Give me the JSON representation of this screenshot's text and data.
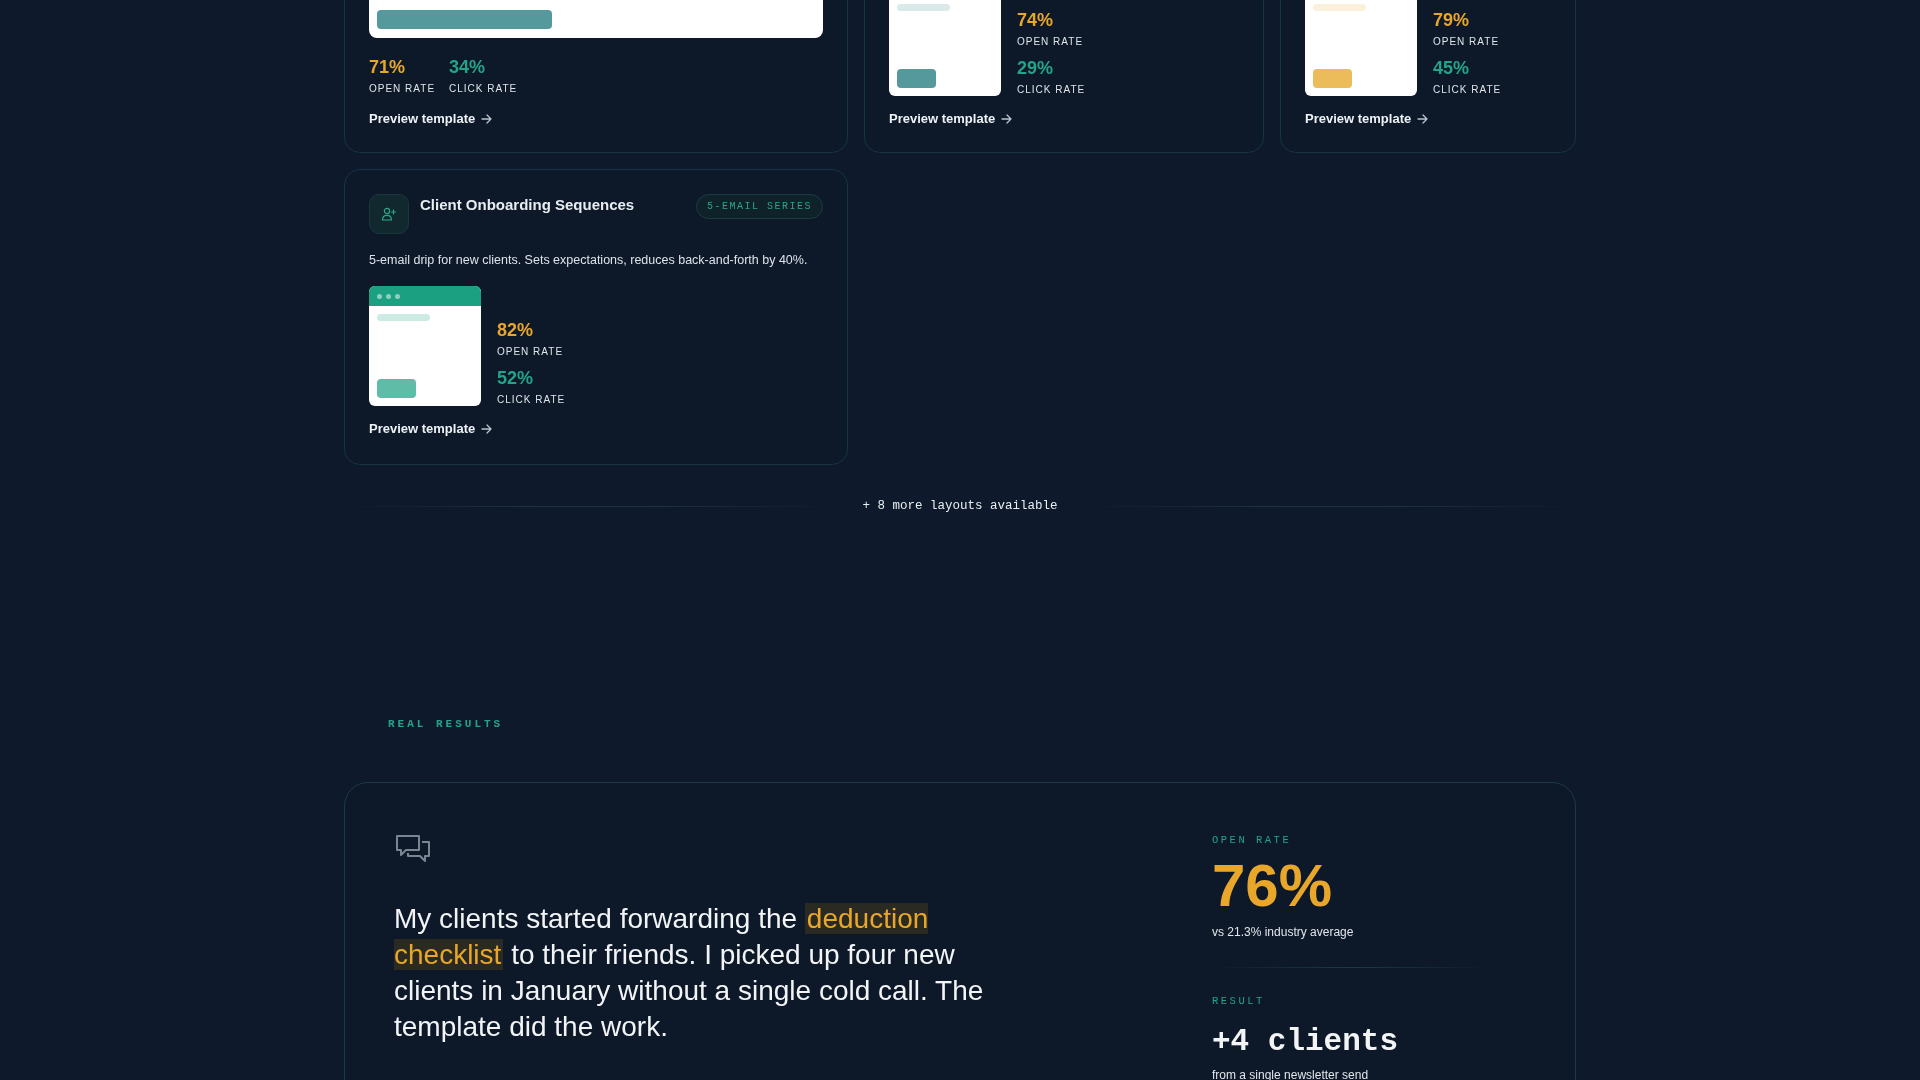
{
  "template_cards": [
    {
      "kind": "wide",
      "preview": {
        "color": "#56999c"
      },
      "stats": [
        {
          "kind": "open",
          "value": "71%",
          "label": "OPEN RATE"
        },
        {
          "kind": "click",
          "value": "34%",
          "label": "CLICK RATE"
        }
      ],
      "link": "Preview template"
    },
    {
      "kind": "side",
      "preview": {
        "color": "#56999c"
      },
      "stats": [
        {
          "kind": "open",
          "value": "74%",
          "label": "OPEN RATE"
        },
        {
          "kind": "click",
          "value": "29%",
          "label": "CLICK RATE"
        }
      ],
      "link": "Preview template"
    },
    {
      "kind": "side",
      "preview": {
        "color": "#ecbb5a"
      },
      "stats": [
        {
          "kind": "open",
          "value": "79%",
          "label": "OPEN RATE"
        },
        {
          "kind": "click",
          "value": "45%",
          "label": "CLICK RATE"
        }
      ],
      "link": "Preview template"
    },
    {
      "kind": "headed",
      "title": "Client Onboarding Sequences",
      "badge": "5-EMAIL SERIES",
      "description": "5-email drip for new clients. Sets expectations, reduces back-and-forth by 40%.",
      "preview": {
        "color": "#1ba081"
      },
      "stats": [
        {
          "kind": "open",
          "value": "82%",
          "label": "OPEN RATE"
        },
        {
          "kind": "click",
          "value": "52%",
          "label": "CLICK RATE"
        }
      ],
      "link": "Preview template"
    }
  ],
  "more_layouts": "+ 8 more layouts available",
  "section_label": "REAL RESULTS",
  "testimonial": {
    "quote": [
      {
        "text": "My clients started forwarding the ",
        "highlight": false
      },
      {
        "text": "deduction checklist",
        "highlight": true
      },
      {
        "text": " to their friends. I picked up four new clients in January without a single cold call. The template did the work.",
        "highlight": false
      }
    ],
    "metrics": [
      {
        "label": "OPEN RATE",
        "kind": "percent",
        "value": "76%",
        "note": "vs 21.3% industry average"
      },
      {
        "label": "RESULT",
        "kind": "count",
        "value": "+4 clients",
        "note": "from a single newsletter send"
      }
    ]
  }
}
